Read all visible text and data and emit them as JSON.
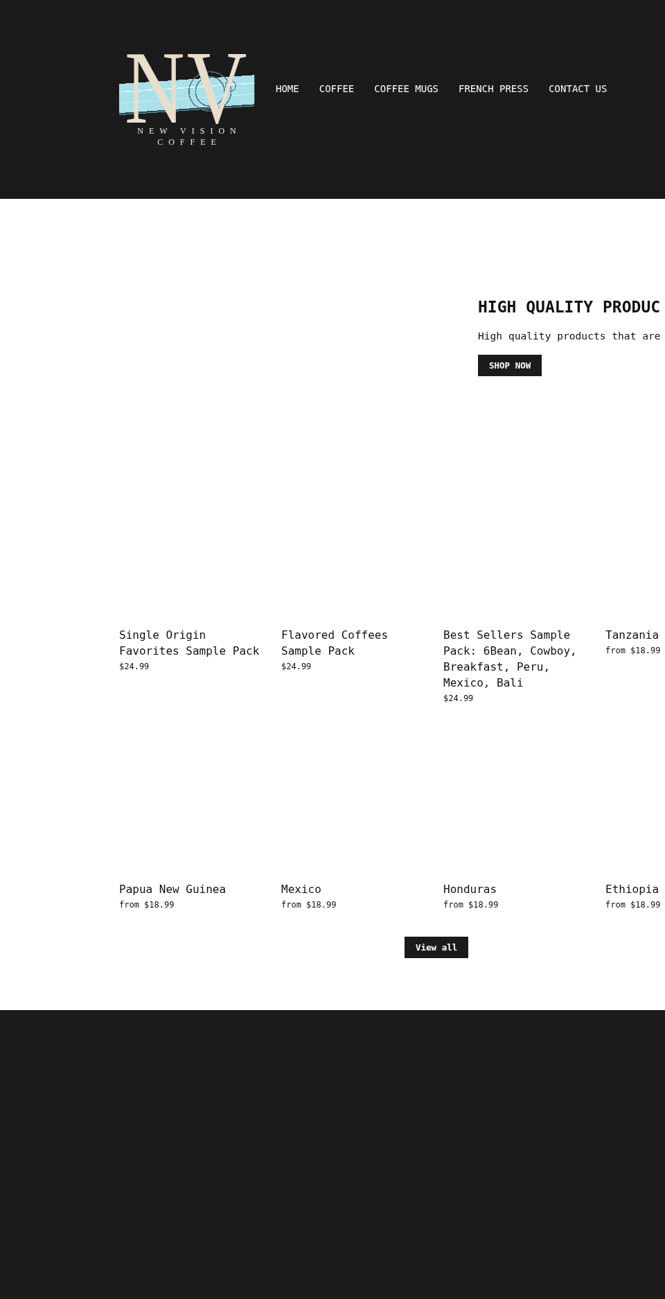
{
  "header": {
    "logo": {
      "monogram": "NV",
      "wordmark": "NEW VISION",
      "tagline": "COFFEE"
    },
    "nav": [
      {
        "label": "HOME"
      },
      {
        "label": "COFFEE"
      },
      {
        "label": "COFFEE MUGS"
      },
      {
        "label": "FRENCH PRESS"
      },
      {
        "label": "CONTACT US"
      }
    ]
  },
  "hero": {
    "title": "HIGH QUALITY PRODUC",
    "subtitle": "High quality products that are",
    "button": "SHOP NOW"
  },
  "products": [
    {
      "title": "Single Origin Favorites Sample Pack",
      "price": "$24.99"
    },
    {
      "title": "Flavored Coffees Sample Pack",
      "price": "$24.99"
    },
    {
      "title": "Best Sellers Sample Pack: 6Bean, Cowboy, Breakfast, Peru, Mexico, Bali",
      "price": "$24.99"
    },
    {
      "title": "Tanzania",
      "price": "from $18.99"
    },
    {
      "title": "Papua New Guinea",
      "price": "from $18.99"
    },
    {
      "title": "Mexico",
      "price": "from $18.99"
    },
    {
      "title": "Honduras",
      "price": "from $18.99"
    },
    {
      "title": "Ethiopia",
      "price": "from $18.99"
    }
  ],
  "view_all_button": "View all"
}
